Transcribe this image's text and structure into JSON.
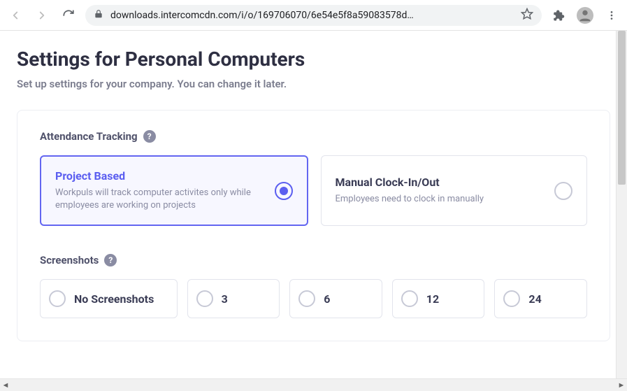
{
  "browser": {
    "url": "downloads.intercomcdn.com/i/o/169706070/6e54e5f8a59083578d…"
  },
  "page": {
    "title": "Settings for Personal Computers",
    "subtitle": "Set up settings for your company. You can change it later."
  },
  "attendance": {
    "label": "Attendance Tracking",
    "options": [
      {
        "title": "Project Based",
        "desc": "Workpuls will track computer activites only while employees are working on projects",
        "selected": true
      },
      {
        "title": "Manual Clock-In/Out",
        "desc": "Employees need to clock in manually",
        "selected": false
      }
    ]
  },
  "screenshots": {
    "label": "Screenshots",
    "options": [
      {
        "label": "No Screenshots"
      },
      {
        "label": "3"
      },
      {
        "label": "6"
      },
      {
        "label": "12"
      },
      {
        "label": "24"
      }
    ]
  }
}
